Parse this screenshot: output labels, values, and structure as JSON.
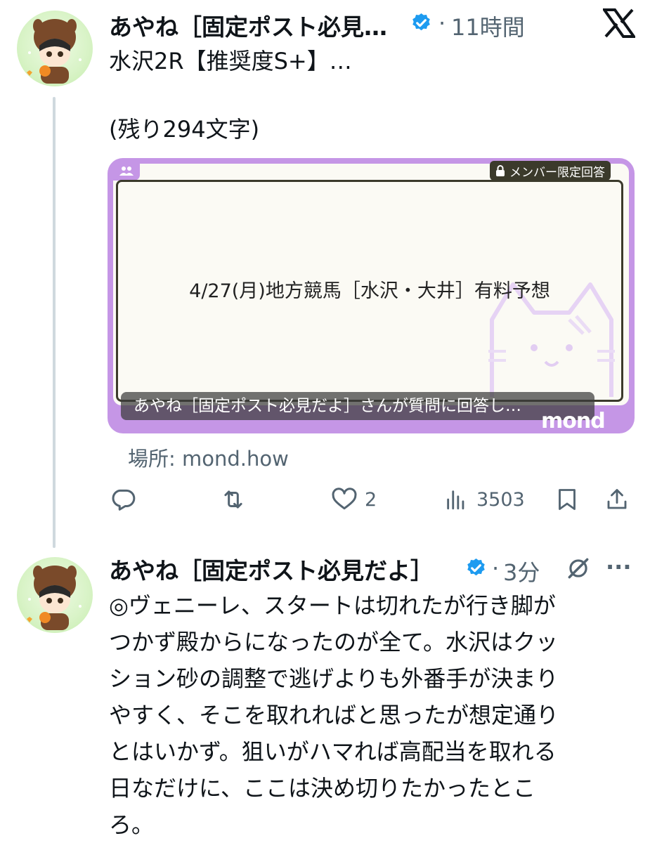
{
  "post1": {
    "author": "あやね［固定ポスト必見…",
    "separator": "·",
    "time": "11時間",
    "text_line1": "水沢2R【推奨度S+】…",
    "text_line2": "(残り294文字)",
    "card": {
      "badge": "メンバー限定回答",
      "title": "4/27(月)地方競馬［水沢・大井］有料予想",
      "caption": "あやね［固定ポスト必見だよ］さんが質問に回答し…",
      "logo": "mond"
    },
    "source": "場所: mond.how",
    "actions": {
      "likes": "2",
      "views": "3503"
    }
  },
  "post2": {
    "author": "あやね［固定ポスト必見だよ］",
    "separator": "·",
    "time": "3分",
    "more": "···",
    "lines": [
      "◎ヴェニーレ、スタートは切れたが行き脚が",
      "つかず殿からになったのが全て。水沢はクッ",
      "ション砂の調整で逃げよりも外番手が決まり",
      "やすく、そこを取れればと思ったが想定通り",
      "とはいかず。狙いがハマれば高配当を取れる",
      "日なだけに、ここは決め切りたかったとこ",
      "ろ。"
    ]
  },
  "icons": {
    "close": "x-logo-icon",
    "verified": "verified-badge-icon",
    "reply": "reply-icon",
    "repost": "repost-icon",
    "like": "heart-icon",
    "views": "views-icon",
    "bookmark": "bookmark-icon",
    "share": "share-icon",
    "edit": "edit-icon"
  },
  "colors": {
    "verified": "#1d9bf0",
    "card_border": "#c596e6",
    "secondary_text": "#536471"
  }
}
